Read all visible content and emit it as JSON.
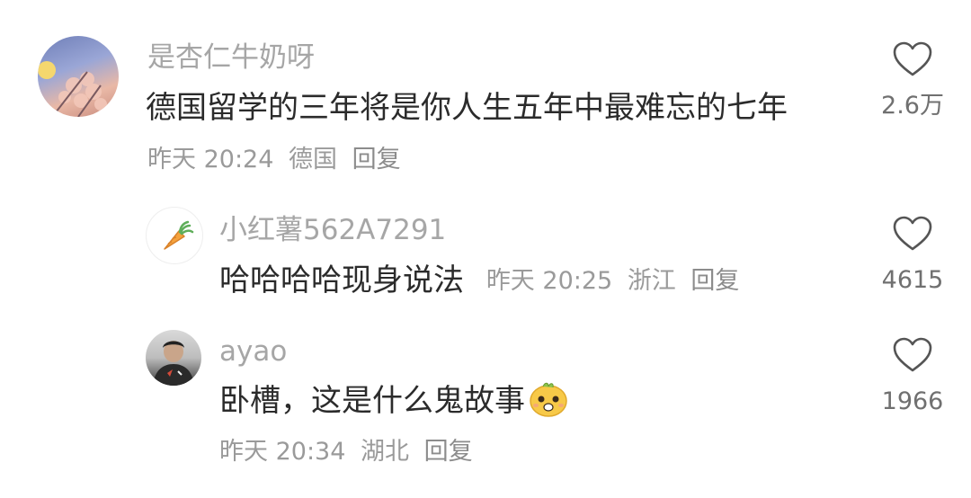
{
  "comments": [
    {
      "username": "是杏仁牛奶呀",
      "text": "德国留学的三年将是你人生五年中最难忘的七年",
      "time": "昨天 20:24",
      "location": "德国",
      "reply_label": "回复",
      "likes": "2.6万",
      "avatar_icon": "avatar-sunset-blossoms"
    }
  ],
  "replies": [
    {
      "username": "小红薯562A7291",
      "text": "哈哈哈哈现身说法",
      "time": "昨天 20:25",
      "location": "浙江",
      "reply_label": "回复",
      "likes": "4615",
      "avatar_icon": "carrot-icon"
    },
    {
      "username": "ayao",
      "text": "卧槽，这是什么鬼故事",
      "time": "昨天 20:34",
      "location": "湖北",
      "reply_label": "回复",
      "likes": "1966",
      "avatar_icon": "avatar-person-photo",
      "emoji_icon": "surprised-chick-emoji"
    }
  ],
  "colors": {
    "username": "#a6a6a6",
    "text": "#2b2b2b",
    "meta": "#9a9a9a",
    "heart": "#555555"
  }
}
